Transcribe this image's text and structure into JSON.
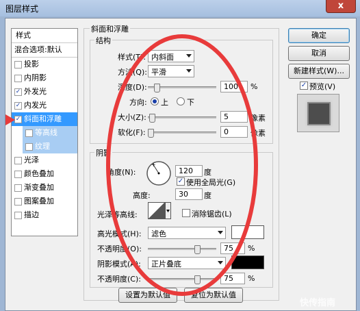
{
  "window": {
    "title": "图层样式",
    "close_glyph": "x"
  },
  "left_panel": {
    "header": "样式",
    "blend_default": "混合选项:默认",
    "items": [
      {
        "label": "投影",
        "checked": false
      },
      {
        "label": "内阴影",
        "checked": false
      },
      {
        "label": "外发光",
        "checked": true
      },
      {
        "label": "内发光",
        "checked": true
      },
      {
        "label": "斜面和浮雕",
        "checked": true,
        "selected": true
      },
      {
        "label": "等高线",
        "checked": false,
        "sub": true
      },
      {
        "label": "纹理",
        "checked": false,
        "sub": true
      },
      {
        "label": "光泽",
        "checked": false
      },
      {
        "label": "颜色叠加",
        "checked": false
      },
      {
        "label": "渐变叠加",
        "checked": false
      },
      {
        "label": "图案叠加",
        "checked": false
      },
      {
        "label": "描边",
        "checked": false
      }
    ],
    "check_glyph": "✓"
  },
  "bevel": {
    "group_title": "斜面和浮雕",
    "structure": {
      "title": "结构",
      "style_label": "样式(T):",
      "style_value": "内斜面",
      "technique_label": "方法(Q):",
      "technique_value": "平滑",
      "depth_label": "深度(D):",
      "depth_value": "100",
      "depth_unit": "%",
      "depth_level": 0.1,
      "direction_label": "方向:",
      "dir_up": "上",
      "dir_down": "下",
      "size_label": "大小(Z):",
      "size_value": "5",
      "size_unit": "像素",
      "size_level": 0.02,
      "soften_label": "软化(F):",
      "soften_value": "0",
      "soften_unit": "像素",
      "soften_level": 0.0
    },
    "shading": {
      "title": "阴影",
      "angle_label": "角度(N):",
      "angle_value": "120",
      "angle_unit": "度",
      "global_light_label": "使用全局光(G)",
      "altitude_label": "高度:",
      "altitude_value": "30",
      "altitude_unit": "度",
      "gloss_label": "光泽等高线:",
      "anti_alias_label": "消除锯齿(L)",
      "highlight_mode_label": "高光模式(H):",
      "highlight_mode_value": "滤色",
      "highlight_color": "#ffffff",
      "highlight_opacity_label": "不透明度(O):",
      "highlight_opacity_value": "75",
      "highlight_opacity_level": 0.75,
      "shadow_mode_label": "阴影模式(A):",
      "shadow_mode_value": "正片叠底",
      "shadow_color": "#000000",
      "shadow_opacity_label": "不透明度(C):",
      "shadow_opacity_value": "75",
      "shadow_opacity_level": 0.75,
      "percent": "%"
    },
    "set_default": "设置为默认值",
    "reset_default": "复位为默认值"
  },
  "right": {
    "ok": "确定",
    "cancel": "取消",
    "new_style": "新建样式(W)...",
    "preview_label": "预览(V)"
  },
  "annotation_color": "#e83b3b",
  "accent": "#3399ff",
  "watermark": "快传指南"
}
